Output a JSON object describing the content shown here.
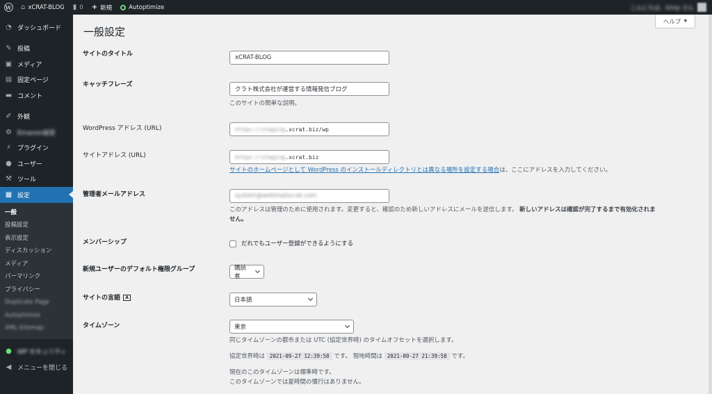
{
  "adminbar": {
    "site_name": "xCRAT-BLOG",
    "comments_count": "0",
    "new_label": "新規",
    "autoptimize_label": "Autoptimize",
    "greeting": "こんにちは、kimp さん"
  },
  "sidebar": {
    "items": [
      {
        "label": "ダッシュボード",
        "icon": "dashboard-icon"
      },
      {
        "label": "投稿",
        "icon": "pin-icon"
      },
      {
        "label": "メディア",
        "icon": "media-icon"
      },
      {
        "label": "固定ページ",
        "icon": "page-icon"
      },
      {
        "label": "コメント",
        "icon": "comment-icon"
      },
      {
        "label": "外観",
        "icon": "brush-icon"
      },
      {
        "label": "Emanon設定",
        "icon": "gear-icon"
      },
      {
        "label": "プラグイン",
        "icon": "plugin-icon"
      },
      {
        "label": "ユーザー",
        "icon": "user-icon"
      },
      {
        "label": "ツール",
        "icon": "wrench-icon"
      },
      {
        "label": "設定",
        "icon": "settings-icon"
      }
    ],
    "submenu": [
      "一般",
      "投稿設定",
      "表示設定",
      "ディスカッション",
      "メディア",
      "パーマリンク",
      "プライバシー",
      "Duplicate Page",
      "Autoptimize",
      "XML-Sitemap"
    ],
    "security": "WP セキュリティ",
    "collapse": "メニューを閉じる"
  },
  "page": {
    "title": "一般設定",
    "help": "ヘルプ"
  },
  "settings": {
    "site_title_label": "サイトのタイトル",
    "site_title_value": "xCRAT-BLOG",
    "tagline_label": "キャッチフレーズ",
    "tagline_value": "クラト株式会社が運営する情報発信ブログ",
    "tagline_desc": "このサイトの簡単な説明。",
    "wp_url_label": "WordPress アドレス (URL)",
    "wp_url_prefix": "https://staging",
    "wp_url_suffix": ".xcrat.biz/wp",
    "site_url_label": "サイトアドレス (URL)",
    "site_url_prefix": "https://staging",
    "site_url_suffix": ".xcrat.biz",
    "site_url_link": "サイトのホームページとして WordPress のインストールディレクトリとは異なる場所を設定する場合",
    "site_url_desc_tail": "は、ここにアドレスを入力してください。",
    "admin_email_label": "管理者メールアドレス",
    "admin_email_value": "system@webmailxcrat.com",
    "admin_email_desc": "このアドレスは管理のために使用されます。変更すると、確認のため新しいアドレスにメールを送信します。",
    "admin_email_bold_1": "新しいアドレスは確認が完了するまで有効化されま",
    "admin_email_bold_2": "せん。",
    "membership_label": "メンバーシップ",
    "membership_checkbox": "だれでもユーザー登録ができるようにする",
    "default_role_label": "新規ユーザーのデフォルト権限グループ",
    "default_role_value": "購読者",
    "language_label": "サイトの言語",
    "language_value": "日本語",
    "timezone_label": "タイムゾーン",
    "timezone_value": "東京",
    "timezone_desc": "同じタイムゾーンの都市または UTC (協定世界時) のタイムオフセットを選択します。",
    "utc_prefix": "協定世界時は",
    "utc_time": "2021-09-27 12:39:58",
    "utc_suffix": "です。",
    "local_prefix": "現地時間は",
    "local_time": "2021-09-27 21:39:58",
    "local_suffix": "です。",
    "std_time": "現在のこのタイムゾーンは標準時です。",
    "no_dst": "このタイムゾーンでは夏時間の慣行はありません。"
  }
}
